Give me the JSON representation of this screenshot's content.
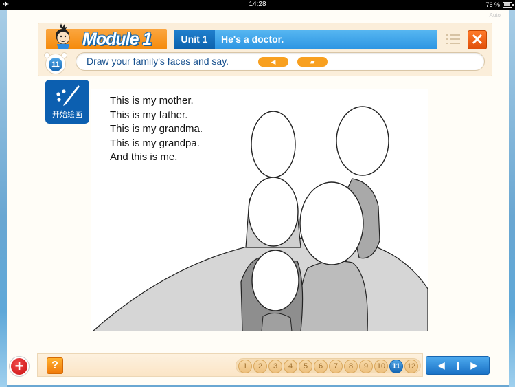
{
  "status_bar": {
    "airplane_icon": "airplane-icon",
    "time": "14:28",
    "battery_percent": "76 %",
    "battery_icon": "battery-icon"
  },
  "auto_label": "Auto",
  "header": {
    "module_title": "Module 1",
    "unit_label": "Unit 1",
    "unit_title": "He's a doctor.",
    "menu_icon": "list-menu-icon",
    "close_icon": "close-icon",
    "close_glyph": "✕"
  },
  "activity": {
    "step_number": "11",
    "instruction": "Draw your family's faces and say.",
    "sound_glyph": "◀",
    "record_glyph": "▰"
  },
  "draw_button": {
    "label": "开始绘画",
    "icon": "paint-brush-icon"
  },
  "content": {
    "sentences": [
      "This is my mother.",
      "This is my father.",
      "This is my grandma.",
      "This is my grandpa.",
      "And this is me."
    ],
    "illustration": "family-faceless-drawing"
  },
  "footer": {
    "add_glyph": "+",
    "help_glyph": "?",
    "pages": [
      "1",
      "2",
      "3",
      "4",
      "5",
      "6",
      "7",
      "8",
      "9",
      "10",
      "11",
      "12"
    ],
    "current_page": "11",
    "prev_glyph": "◀",
    "next_glyph": "▶"
  },
  "colors": {
    "brand_orange": "#f58a0a",
    "brand_blue": "#0c5fb0",
    "unit_blue": "#2e96e3",
    "close_red": "#e04f0a",
    "add_red": "#c90f0f"
  }
}
